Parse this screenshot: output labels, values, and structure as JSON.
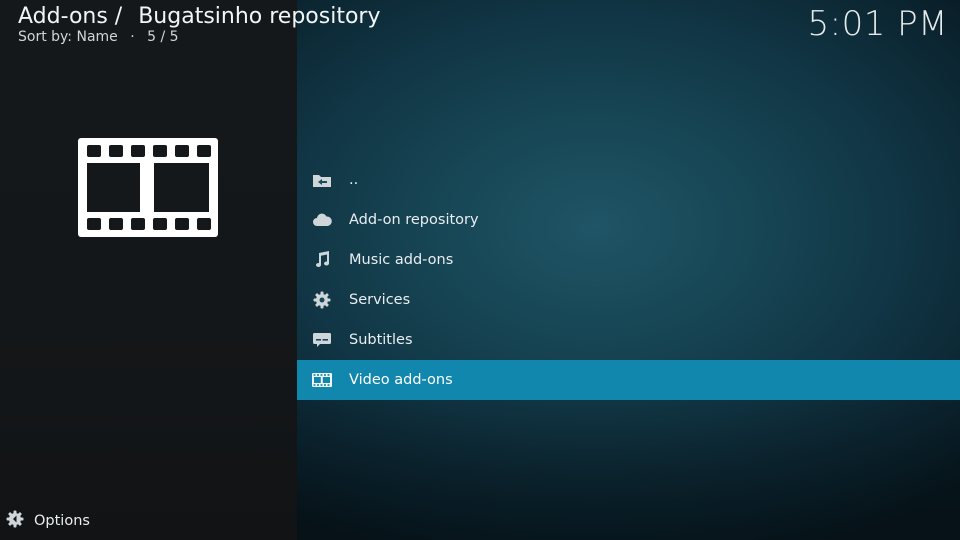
{
  "header": {
    "breadcrumb_root": "Add-ons /",
    "breadcrumb_current": "Bugatsinho repository",
    "sort_label": "Sort by: Name",
    "position": "5 / 5"
  },
  "clock": "5:01 PM",
  "hero": {
    "icon": "film-strip-icon"
  },
  "menu": {
    "items": [
      {
        "label": "..",
        "icon": "folder-back-icon"
      },
      {
        "label": "Add-on repository",
        "icon": "cloud-icon"
      },
      {
        "label": "Music add-ons",
        "icon": "music-note-icon"
      },
      {
        "label": "Services",
        "icon": "gear-icon"
      },
      {
        "label": "Subtitles",
        "icon": "subtitles-icon"
      },
      {
        "label": "Video add-ons",
        "icon": "film-icon"
      }
    ],
    "selected_index": 5
  },
  "footer": {
    "options_label": "Options",
    "icon": "options-icon"
  },
  "colors": {
    "selection": "#1187ad",
    "left_panel": "#15181b",
    "right_panel": "#174655",
    "text": "#e9eef0"
  }
}
